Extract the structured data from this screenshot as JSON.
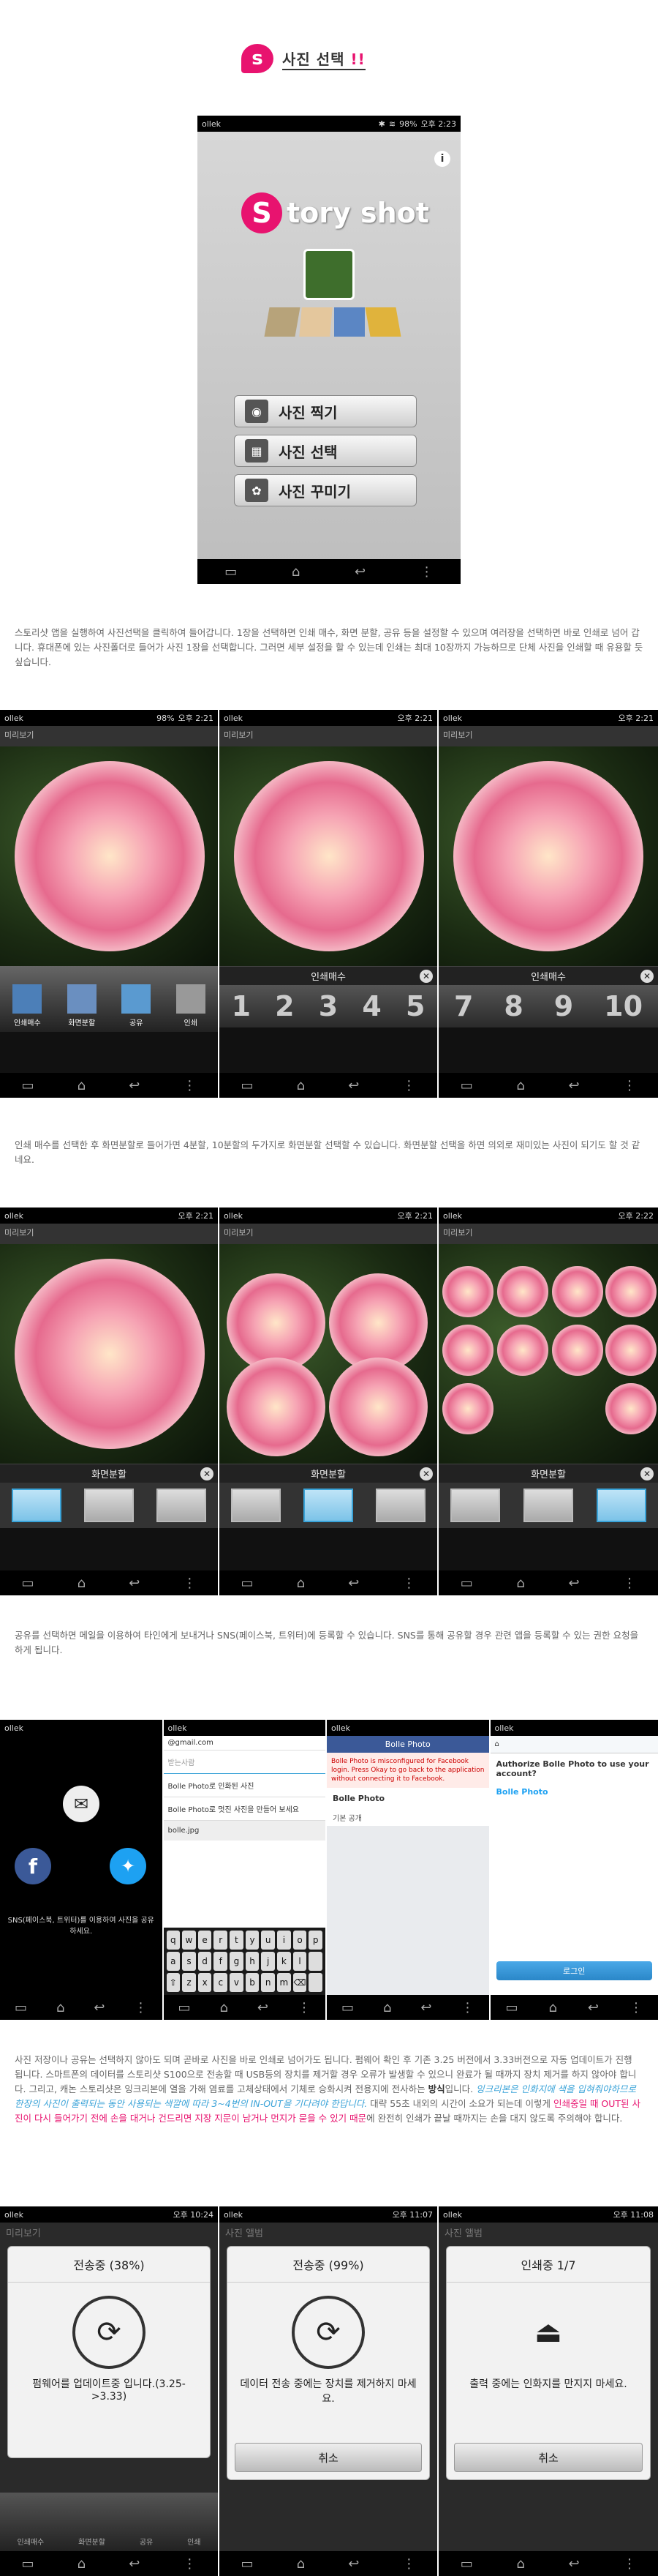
{
  "section_title": {
    "badge": "s",
    "text": "사진 선택",
    "suffix": "!!"
  },
  "status": {
    "carrier": "ollek",
    "battery": "98%",
    "time_1": "오후 2:23",
    "time_2": "오후 2:21",
    "time_3": "오후 2:22",
    "time_4": "오후 10:24",
    "time_5": "오후 11:07",
    "time_6": "오후 11:08"
  },
  "main_app": {
    "logo_s": "S",
    "logo_rest": "tory shot",
    "info_icon": "i",
    "menu": [
      "사진 찍기",
      "사진 선택",
      "사진 꾸미기"
    ]
  },
  "paragraphs": {
    "p1": "스토리샷 앱을 실행하여 사진선택을 클릭하여 들어갑니다. 1장을 선택하면 인쇄 매수, 화면 분할, 공유 등을 설정할 수 있으며 여러장을 선택하면 바로 인쇄로 넘어 갑니다. 휴대폰에 있는 사진폴더로 들어가 사진 1장을 선택합니다. 그러면 세부 설정을 할 수 있는데 인쇄는 최대 10장까지 가능하므로 단체 사진을 인쇄할 때 유용할 듯 싶습니다.",
    "p2": "인쇄 매수를 선택한 후 화면분할로 들어가면 4분할, 10분할의 두가지로 화면분할 선택할 수 있습니다. 화면분할 선택을 하면 의외로 재미있는 사진이 되기도 할 것 같네요.",
    "p3": "공유를 선택하면 메일을 이용하여 타인에게 보내거나 SNS(페이스북, 트위터)에 등록할 수 있습니다. SNS를 통해 공유할 경우 관련 앱을 등록할 수 있는 권한 요청을 하게 됩니다.",
    "p4a": "사진 저장이나 공유는 선택하지 않아도 되며 곧바로 사진을 바로 인쇄로 넘어가도 됩니다. 펌웨어 확인 후 기존 3.25 버전에서 3.33버전으로 자동 업데이트가 진행 됩니다. 스마트폰의 데이터를 스토리샷 S100으로 전송할 때 USB등의 장치를 제거할 경우 오류가 발생할 수 있으니 완료가 될 때까지 장치 제거를 하지 않아야 합니다. 그리고, 캐논 스토리샷은 잉크리본에 열을 가해 염료를 고체상태에서 기체로 승화시켜 전용지에 전사하는",
    "p4b": "방식",
    "p4c": "입니다.",
    "p4d": "잉크리본은 인화지에 색을 입혀줘야하므로 한장의 사진이 출력되는 동안 사용되는 색깔에 따라 3~4번의 IN-OUT을 기다려야 한답니다.",
    "p4e": "대략 55초 내외의 시간이 소요가 되는데 이렇게",
    "p4f": "인쇄중일 때 OUT된 사진이 다시 들어가기 전에 손을 대거나 건드리면 지장 지문이 남거나 먼지가 묻을 수 있기 때문",
    "p4g": "에 완전히 인쇄가 끝날 때까지는 손을 대지 않도록 주의해야 합니다."
  },
  "bottom_menu": [
    "인쇄매수",
    "화면분할",
    "공유",
    "인쇄"
  ],
  "print_count": {
    "title": "인쇄매수",
    "numbers": [
      "1",
      "2",
      "3",
      "4",
      "5",
      "7",
      "8",
      "9",
      "10"
    ]
  },
  "split": {
    "title": "화면분할"
  },
  "share": {
    "sns_text": "SNS(페이스북, 트위터)를 이용하여 사진을 공유하세요.",
    "mail_from": "@gmail.com",
    "mail_to": "받는사람",
    "mail_subject": "Bolle Photo로 인화된 사진",
    "mail_body": "Bolle Photo로 멋진 사진을 만들어 보세요",
    "mail_attach": "bolle.jpg",
    "keyboard": [
      "q",
      "w",
      "e",
      "r",
      "t",
      "y",
      "u",
      "i",
      "o",
      "p",
      "a",
      "s",
      "d",
      "f",
      "g",
      "h",
      "j",
      "k",
      "l",
      "",
      "z",
      "x",
      "c",
      "v",
      "b",
      "n",
      "m",
      "",
      "",
      ""
    ],
    "fb_title": "Bolle Photo",
    "fb_warning": "Bolle Photo is misconfigured for Facebook login. Press Okay to go back to the application without connecting it to Facebook.",
    "fb_app": "Bolle Photo",
    "fb_privacy": "기본 공개",
    "tw_title": "Authorize Bolle Photo to use your account?",
    "tw_app": "Bolle Photo",
    "tw_user": "로그인"
  },
  "transfer": [
    {
      "header": "전송중 (38%)",
      "msg": "펌웨어를 업데이트중 입니다.(3.25->3.33)",
      "cancel": ""
    },
    {
      "header": "전송중 (99%)",
      "msg": "데이터 전송 중에는 장치를 제거하지 마세요.",
      "cancel": "취소"
    },
    {
      "header": "인쇄중 1/7",
      "msg": "출력 중에는 인화지를 만지지 마세요.",
      "cancel": "취소"
    }
  ],
  "bg_labels": {
    "album": "사진 앨범",
    "preview": "미리보기"
  }
}
